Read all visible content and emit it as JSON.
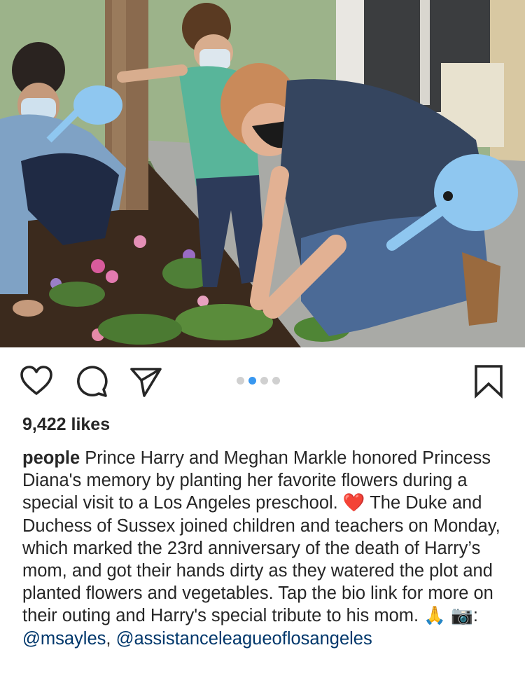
{
  "post": {
    "image_alt": "",
    "carousel": {
      "count": 4,
      "active_index": 1
    },
    "likes_text": "9,422 likes",
    "caption": {
      "username": "people",
      "text_1": " Prince Harry and Meghan Markle honored Princess Diana's memory by planting her favorite flowers during a special visit to a Los Angeles preschool. ",
      "emoji_heart": "❤️",
      "text_2": " The Duke and Duchess of Sussex joined children and teachers on Monday, which marked the 23rd anniversary of the death of Harry’s mom, and got their hands dirty as they watered the plot and planted flowers and vegetables. Tap the bio link for more on their outing and Harry's special tribute to his mom. ",
      "emoji_pray": "🙏",
      "emoji_camera": "📷",
      "credit_sep": ": ",
      "mention_1": "@msayles",
      "comma": ",",
      "mention_2": "@assistanceleagueoflosangeles"
    }
  },
  "icons": {
    "like": "heart-outline",
    "comment": "speech-bubble",
    "share": "paper-plane",
    "save": "bookmark"
  },
  "colors": {
    "text": "#262626",
    "active_dot": "#3897f0",
    "inactive_dot": "#d0d0d0",
    "mention": "#00376b"
  }
}
